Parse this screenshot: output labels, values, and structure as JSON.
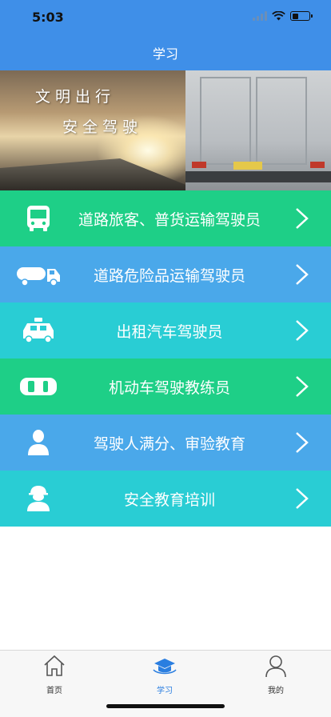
{
  "status_bar": {
    "time": "5:03"
  },
  "nav": {
    "title": "学习"
  },
  "banner": {
    "slogan_line1": "文明出行",
    "slogan_line2": "安全驾驶"
  },
  "menu": {
    "items": [
      {
        "label": "道路旅客、普货运输驾驶员",
        "icon": "bus-icon",
        "color": "#1ecf87"
      },
      {
        "label": "道路危险品运输驾驶员",
        "icon": "tanker-truck-icon",
        "color": "#4aa8ea"
      },
      {
        "label": "出租汽车驾驶员",
        "icon": "taxi-icon",
        "color": "#29cdd4"
      },
      {
        "label": "机动车驾驶教练员",
        "icon": "car-topview-icon",
        "color": "#1ecf87"
      },
      {
        "label": "驾驶人满分、审验教育",
        "icon": "person-icon",
        "color": "#4aa8ea"
      },
      {
        "label": "安全教育培训",
        "icon": "worker-helmet-icon",
        "color": "#29cdd4"
      }
    ]
  },
  "tabs": {
    "home": {
      "label": "首页",
      "icon": "home-icon"
    },
    "study": {
      "label": "学习",
      "icon": "graduation-cap-icon",
      "active": true
    },
    "mine": {
      "label": "我的",
      "icon": "user-icon"
    }
  },
  "colors": {
    "nav_blue": "#3f8fe8",
    "active_tab": "#2a7ee0"
  }
}
